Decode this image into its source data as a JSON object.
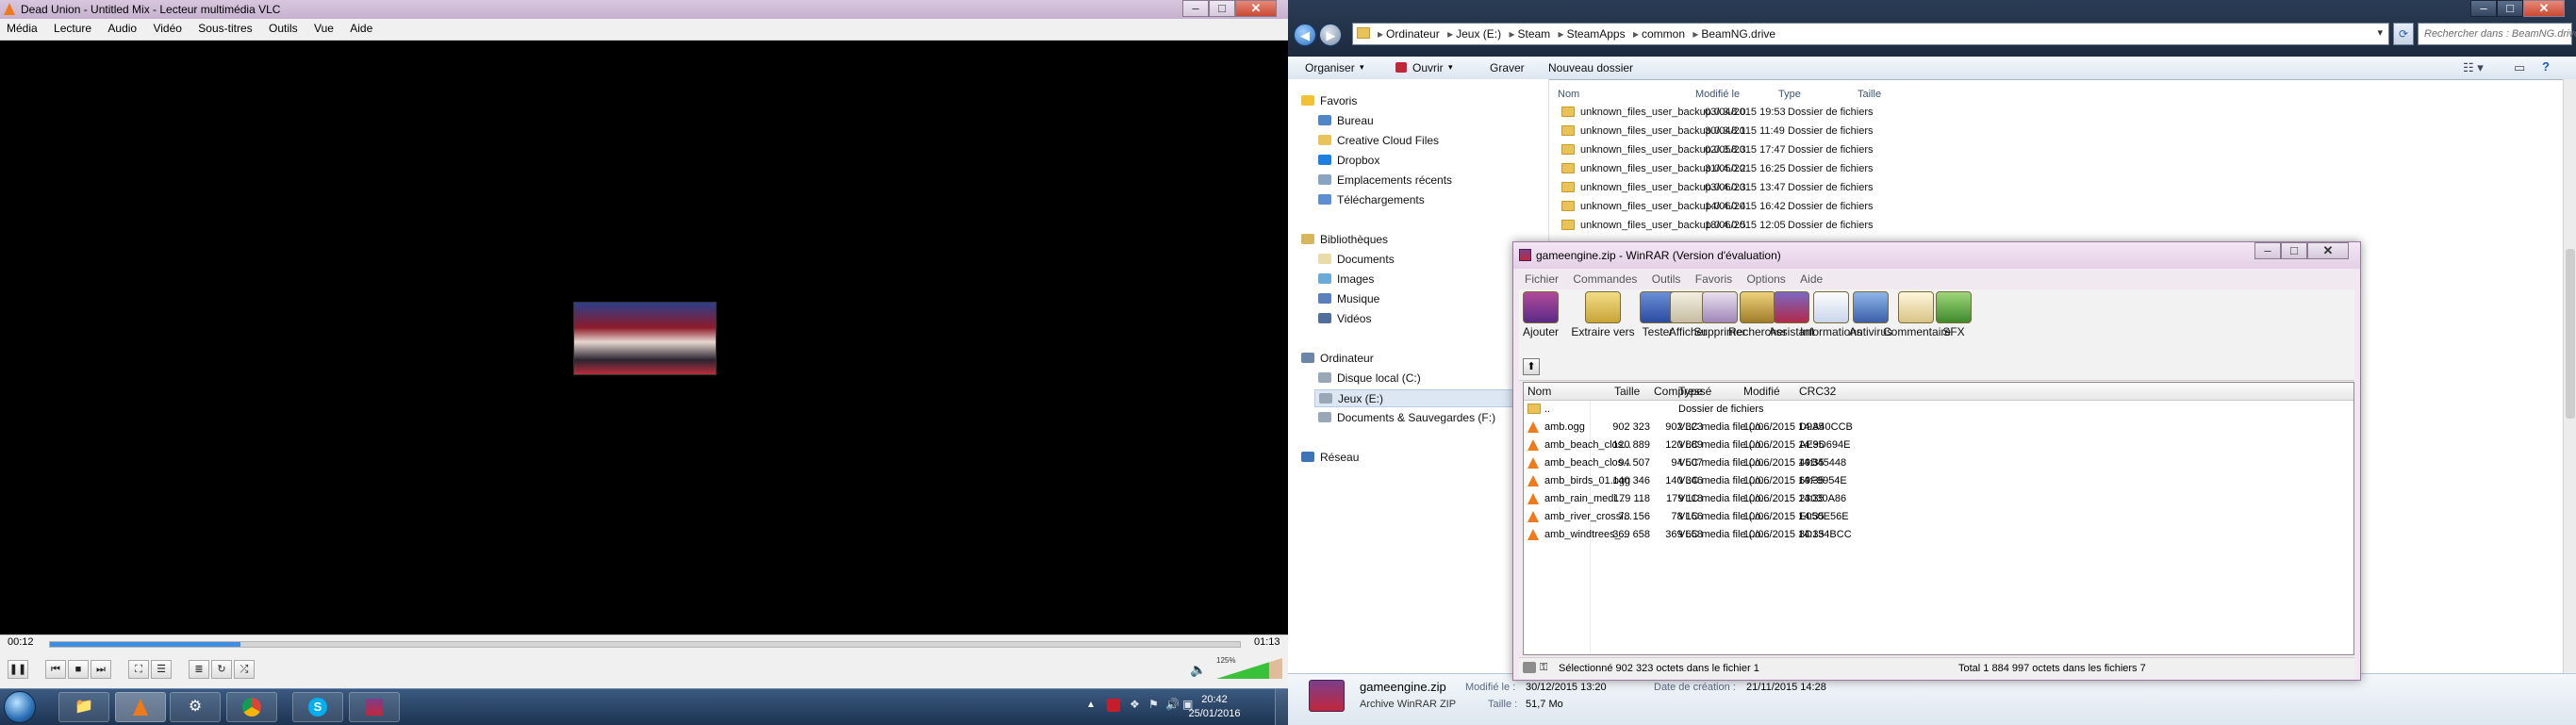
{
  "vlc": {
    "title": "Dead Union - Untitled Mix - Lecteur multimédia VLC",
    "menu": [
      "Média",
      "Lecture",
      "Audio",
      "Vidéo",
      "Sous-titres",
      "Outils",
      "Vue",
      "Aide"
    ],
    "elapsed": "00:12",
    "duration": "01:13",
    "progress": 0.16,
    "volume_percent": "125%"
  },
  "explorer": {
    "breadcrumb": [
      "Ordinateur",
      "Jeux (E:)",
      "Steam",
      "SteamApps",
      "common",
      "BeamNG.drive"
    ],
    "search_placeholder": "Rechercher dans : BeamNG.drive",
    "toolbar": [
      "Organiser",
      "Ouvrir",
      "Graver",
      "Nouveau dossier"
    ],
    "nav": {
      "favorites": "Favoris",
      "favorites_items": [
        "Bureau",
        "Creative Cloud Files",
        "Dropbox",
        "Emplacements récents",
        "Téléchargements"
      ],
      "libraries": "Bibliothèques",
      "libraries_items": [
        "Documents",
        "Images",
        "Musique",
        "Vidéos"
      ],
      "computer": "Ordinateur",
      "computer_items": [
        "Disque local (C:)",
        "Jeux (E:)",
        "Documents & Sauvegardes (F:)"
      ],
      "network": "Réseau"
    },
    "columns": [
      "Nom",
      "Modifié le",
      "Type",
      "Taille"
    ],
    "files": [
      {
        "name": "unknown_files_user_backup.0.3.8.0",
        "date": "03/04/2015 19:53",
        "type": "Dossier de fichiers"
      },
      {
        "name": "unknown_files_user_backup.0.3.8.1",
        "date": "30/04/2015 11:49",
        "type": "Dossier de fichiers"
      },
      {
        "name": "unknown_files_user_backup.0.3.8.3",
        "date": "02/05/2015 17:47",
        "type": "Dossier de fichiers"
      },
      {
        "name": "unknown_files_user_backup.0.4.0.2",
        "date": "31/05/2015 16:25",
        "type": "Dossier de fichiers"
      },
      {
        "name": "unknown_files_user_backup.0.4.0.3",
        "date": "03/06/2015 13:47",
        "type": "Dossier de fichiers"
      },
      {
        "name": "unknown_files_user_backup.0.4.0.4",
        "date": "14/06/2015 16:42",
        "type": "Dossier de fichiers"
      },
      {
        "name": "unknown_files_user_backup.0.4.0.5",
        "date": "18/06/2015 12:05",
        "type": "Dossier de fichiers"
      }
    ],
    "details": {
      "filename": "gameengine.zip",
      "filetype": "Archive WinRAR ZIP",
      "modified_label": "Modifié le :",
      "modified": "30/12/2015 13:20",
      "size_label": "Taille :",
      "size": "51,7 Mo",
      "created_label": "Date de création :",
      "created": "21/11/2015 14:28"
    }
  },
  "winrar": {
    "title": "gameengine.zip - WinRAR (Version d'évaluation)",
    "menu": [
      "Fichier",
      "Commandes",
      "Outils",
      "Favoris",
      "Options",
      "Aide"
    ],
    "tools": [
      "Ajouter",
      "Extraire vers",
      "Tester",
      "Afficher",
      "Supprimer",
      "Rechercher",
      "Assistant",
      "Informations",
      "Antivirus",
      "Commentaire",
      "SFX"
    ],
    "columns": [
      "Nom",
      "Taille",
      "Compressé",
      "Type",
      "Modifié",
      "CRC32"
    ],
    "rows": [
      {
        "name": "..",
        "size": "",
        "packed": "",
        "type": "Dossier de fichiers",
        "modified": "",
        "crc": ""
      },
      {
        "name": "amb.ogg",
        "size": "902 323",
        "packed": "902 323",
        "type": "VLC media file (.o...",
        "modified": "10/06/2015 14:35",
        "crc": "D9A40CCB"
      },
      {
        "name": "amb_beach_clos...",
        "size": "120 889",
        "packed": "120 889",
        "type": "VLC media file (.o...",
        "modified": "10/06/2015 14:35",
        "crc": "AE9D694E"
      },
      {
        "name": "amb_beach_clos...",
        "size": "94 507",
        "packed": "94 507",
        "type": "VLC media file (.o...",
        "modified": "10/06/2015 14:35",
        "crc": "49B45448"
      },
      {
        "name": "amb_birds_01.ogg",
        "size": "140 346",
        "packed": "140 346",
        "type": "VLC media file (.o...",
        "modified": "10/06/2015 14:35",
        "crc": "69F9954E"
      },
      {
        "name": "amb_rain_medi...",
        "size": "179 118",
        "packed": "179 118",
        "type": "VLC media file (.o...",
        "modified": "10/06/2015 14:35",
        "crc": "23030A86"
      },
      {
        "name": "amb_river_crossi...",
        "size": "78 156",
        "packed": "78 156",
        "type": "VLC media file (.o...",
        "modified": "10/06/2015 14:35",
        "crc": "E050E56E"
      },
      {
        "name": "amb_windtrees_...",
        "size": "369 658",
        "packed": "369 658",
        "type": "VLC media file (.o...",
        "modified": "10/06/2015 14:35",
        "crc": "8D134BCC"
      }
    ],
    "status_left": "Sélectionné 902 323 octets dans le fichier 1",
    "status_right": "Total 1 884 997 octets dans les fichiers 7"
  },
  "taskbar": {
    "time": "20:42",
    "date": "25/01/2016"
  }
}
